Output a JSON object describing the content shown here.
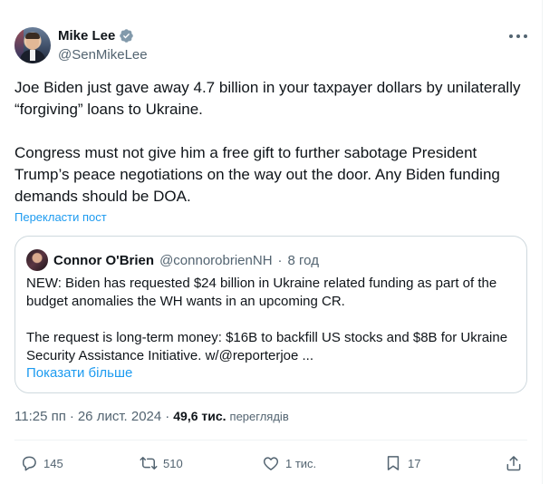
{
  "author": {
    "name": "Mike Lee",
    "handle": "@SenMikeLee",
    "verified": true
  },
  "tweet": {
    "paragraph1": "Joe Biden just gave away 4.7 billion in your taxpayer dollars by unilaterally “forgiving” loans to Ukraine.",
    "paragraph2": "Congress must not give him a free gift to further sabotage President Trump’s peace negotiations on the way out the door. Any Biden funding demands should be DOA.",
    "translate_label": "Перекласти пост"
  },
  "quote": {
    "name": "Connor O'Brien",
    "handle": "@connorobrienNH",
    "separator": "·",
    "time": "8 год",
    "paragraph1": "NEW: Biden has requested $24 billion in Ukraine related funding as part of the budget anomalies the WH wants in an upcoming CR.",
    "paragraph2": "The request is long-term money: $16B to backfill US stocks and $8B for Ukraine Security Assistance Initiative. w/@reporterjoe ...",
    "show_more": "Показати більше"
  },
  "meta": {
    "time": "11:25 пп",
    "dot1": "·",
    "date": "26 лист. 2024",
    "dot2": "·",
    "views_count": "49,6 тис.",
    "views_label": "переглядів"
  },
  "actions": {
    "replies": "145",
    "reposts": "510",
    "likes": "1 тис.",
    "bookmarks": "17"
  },
  "colors": {
    "accent": "#1d9bf0",
    "text": "#0f1419",
    "secondary": "#536471",
    "border": "#cfd9de"
  },
  "icons": [
    "verified-badge-icon",
    "more-icon",
    "reply-icon",
    "repost-icon",
    "like-icon",
    "bookmark-icon",
    "share-icon"
  ]
}
